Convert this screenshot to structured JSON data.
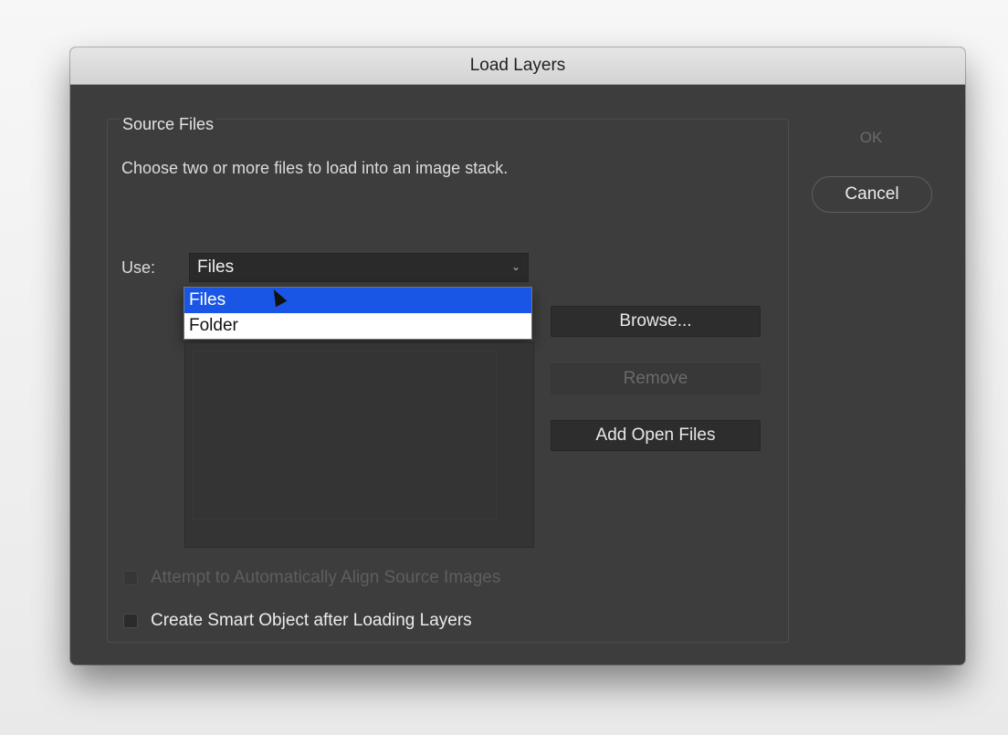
{
  "dialog": {
    "title": "Load Layers",
    "group_label": "Source Files",
    "description": "Choose two or more files to load into an image stack.",
    "use_label": "Use:",
    "use_select": {
      "value": "Files",
      "options": [
        "Files",
        "Folder"
      ],
      "selected_option": "Files"
    },
    "buttons": {
      "browse": "Browse...",
      "remove": "Remove",
      "add_open_files": "Add Open Files",
      "ok": "OK",
      "cancel": "Cancel"
    },
    "checkboxes": {
      "auto_align": {
        "label": "Attempt to Automatically Align Source Images",
        "checked": false,
        "disabled": true
      },
      "smart_object": {
        "label": "Create Smart Object after Loading Layers",
        "checked": false,
        "disabled": false
      }
    }
  },
  "icons": {
    "chevron": "chevron-down-icon",
    "cursor": "mouse-cursor-icon"
  },
  "colors": {
    "dialog_bg": "#3d3d3d",
    "highlight": "#1a56e6"
  }
}
